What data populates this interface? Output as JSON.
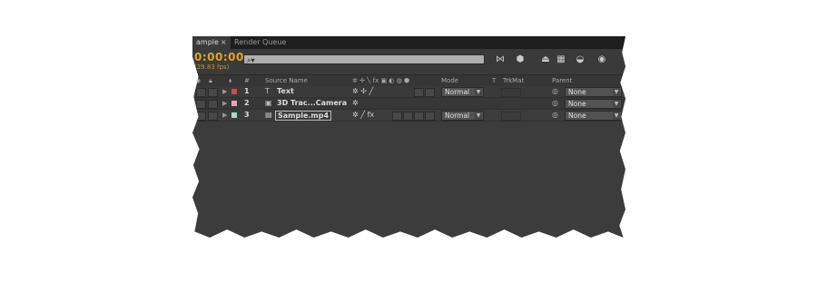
{
  "tabs": [
    {
      "label": "ample",
      "close": "×",
      "active": true
    },
    {
      "label": "Render Queue",
      "active": false
    }
  ],
  "toolbar": {
    "timecode": "0:00:00",
    "fps": "(29.83 fps)",
    "search_glyph": "⌕▾",
    "icons": [
      "composition-mini-flowchart-icon",
      "draft-3d-icon",
      "shy-layers-icon",
      "frame-blending-icon",
      "motion-blur-icon",
      "graph-editor-icon"
    ]
  },
  "columns": {
    "hash": "#",
    "source_name": "Source Name",
    "mode": "Mode",
    "t": "T",
    "trkmat": "TrkMat",
    "parent": "Parent",
    "switch_icons": "✲ ✢ ╲ fx ▣ ◐ ◍ ⬢"
  },
  "layers": [
    {
      "number": "1",
      "label_color": "#d04848",
      "type_glyph": "T",
      "name": "Text",
      "selected": false,
      "switches": "✲ ✢ ╱",
      "mode": "Normal",
      "parent_glyph": "◎",
      "parent": "None"
    },
    {
      "number": "2",
      "label_color": "#e3a8b8",
      "type_glyph": "▣",
      "name": "3D Trac...Camera",
      "selected": false,
      "switches": "✲",
      "mode": "",
      "parent_glyph": "◎",
      "parent": "None"
    },
    {
      "number": "3",
      "label_color": "#a9d6d6",
      "type_glyph": "▤",
      "name": "Sample.mp4",
      "selected": true,
      "switches": "✲ ╱ fx",
      "mode": "Normal",
      "parent_glyph": "◎",
      "parent": "None"
    }
  ]
}
